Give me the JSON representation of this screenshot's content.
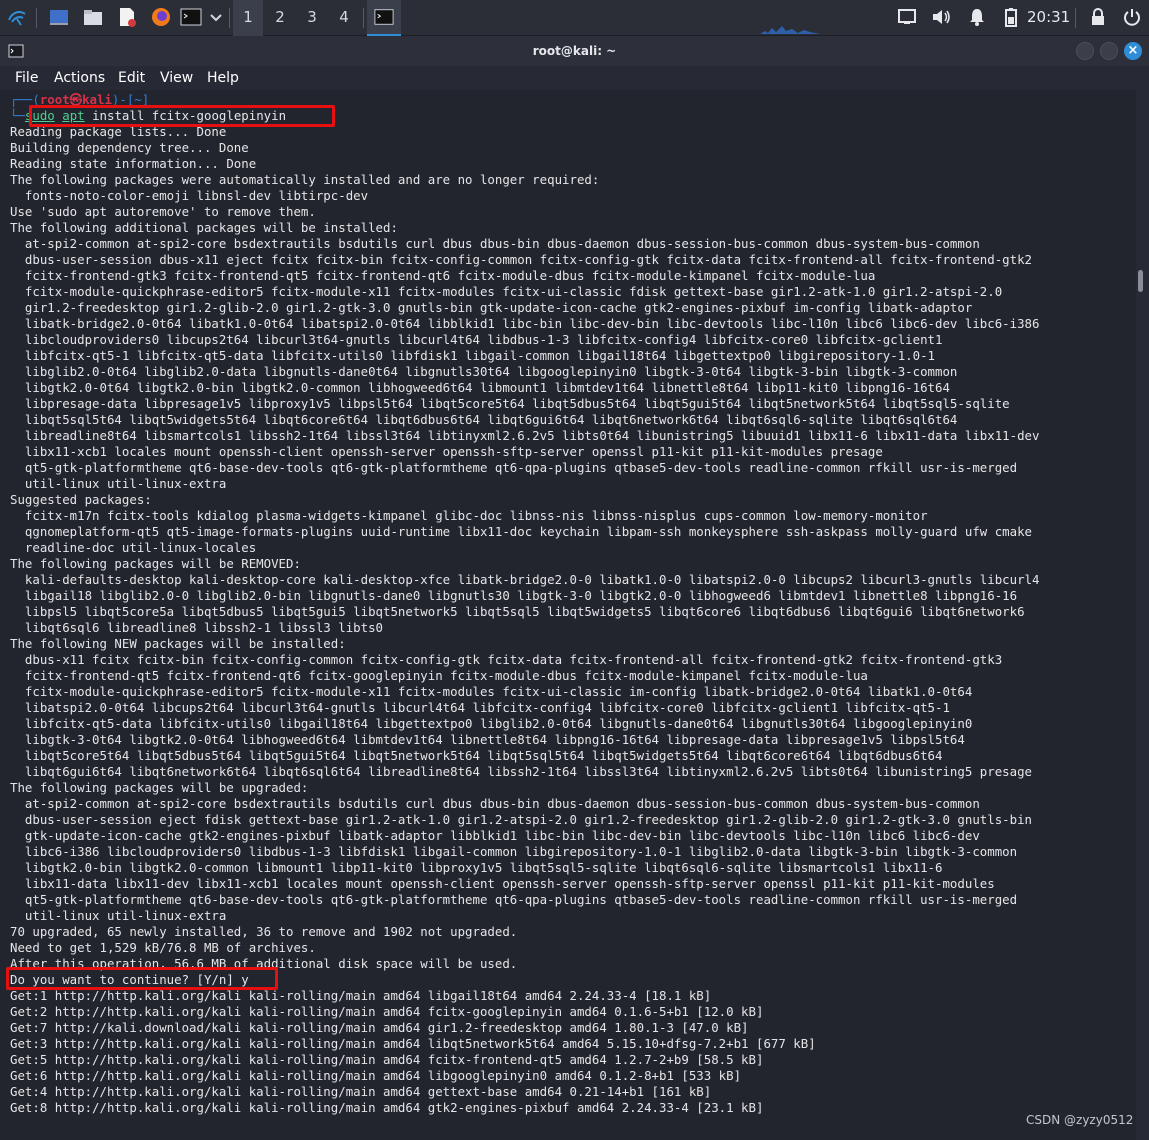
{
  "taskbar": {
    "workspaces": [
      "1",
      "2",
      "3",
      "4"
    ],
    "clock": "20:31"
  },
  "window": {
    "title": "root@kali: ~",
    "menu": [
      "File",
      "Actions",
      "Edit",
      "View",
      "Help"
    ]
  },
  "terminal": {
    "prompt": {
      "top": "┌──(",
      "user": "root㉿kali",
      "path": ")-[~]",
      "hash": "└─",
      "sudo": "sudo",
      "apt": "apt",
      "rest": " install fcitx-googlepinyin"
    },
    "lines": [
      "Reading package lists... Done",
      "Building dependency tree... Done",
      "Reading state information... Done",
      "The following packages were automatically installed and are no longer required:",
      "  fonts-noto-color-emoji libnsl-dev libtirpc-dev",
      "Use 'sudo apt autoremove' to remove them.",
      "The following additional packages will be installed:",
      "  at-spi2-common at-spi2-core bsdextrautils bsdutils curl dbus dbus-bin dbus-daemon dbus-session-bus-common dbus-system-bus-common",
      "  dbus-user-session dbus-x11 eject fcitx fcitx-bin fcitx-config-common fcitx-config-gtk fcitx-data fcitx-frontend-all fcitx-frontend-gtk2",
      "  fcitx-frontend-gtk3 fcitx-frontend-qt5 fcitx-frontend-qt6 fcitx-module-dbus fcitx-module-kimpanel fcitx-module-lua",
      "  fcitx-module-quickphrase-editor5 fcitx-module-x11 fcitx-modules fcitx-ui-classic fdisk gettext-base gir1.2-atk-1.0 gir1.2-atspi-2.0",
      "  gir1.2-freedesktop gir1.2-glib-2.0 gir1.2-gtk-3.0 gnutls-bin gtk-update-icon-cache gtk2-engines-pixbuf im-config libatk-adaptor",
      "  libatk-bridge2.0-0t64 libatk1.0-0t64 libatspi2.0-0t64 libblkid1 libc-bin libc-dev-bin libc-devtools libc-l10n libc6 libc6-dev libc6-i386",
      "  libcloudproviders0 libcups2t64 libcurl3t64-gnutls libcurl4t64 libdbus-1-3 libfcitx-config4 libfcitx-core0 libfcitx-gclient1",
      "  libfcitx-qt5-1 libfcitx-qt5-data libfcitx-utils0 libfdisk1 libgail-common libgail18t64 libgettextpo0 libgirepository-1.0-1",
      "  libglib2.0-0t64 libglib2.0-data libgnutls-dane0t64 libgnutls30t64 libgooglepinyin0 libgtk-3-0t64 libgtk-3-bin libgtk-3-common",
      "  libgtk2.0-0t64 libgtk2.0-bin libgtk2.0-common libhogweed6t64 libmount1 libmtdev1t64 libnettle8t64 libp11-kit0 libpng16-16t64",
      "  libpresage-data libpresage1v5 libproxy1v5 libpsl5t64 libqt5core5t64 libqt5dbus5t64 libqt5gui5t64 libqt5network5t64 libqt5sql5-sqlite",
      "  libqt5sql5t64 libqt5widgets5t64 libqt6core6t64 libqt6dbus6t64 libqt6gui6t64 libqt6network6t64 libqt6sql6-sqlite libqt6sql6t64",
      "  libreadline8t64 libsmartcols1 libssh2-1t64 libssl3t64 libtinyxml2.6.2v5 libts0t64 libunistring5 libuuid1 libx11-6 libx11-data libx11-dev",
      "  libx11-xcb1 locales mount openssh-client openssh-server openssh-sftp-server openssl p11-kit p11-kit-modules presage",
      "  qt5-gtk-platformtheme qt6-base-dev-tools qt6-gtk-platformtheme qt6-qpa-plugins qtbase5-dev-tools readline-common rfkill usr-is-merged",
      "  util-linux util-linux-extra",
      "Suggested packages:",
      "  fcitx-m17n fcitx-tools kdialog plasma-widgets-kimpanel glibc-doc libnss-nis libnss-nisplus cups-common low-memory-monitor",
      "  qgnomeplatform-qt5 qt5-image-formats-plugins uuid-runtime libx11-doc keychain libpam-ssh monkeysphere ssh-askpass molly-guard ufw cmake",
      "  readline-doc util-linux-locales",
      "The following packages will be REMOVED:",
      "  kali-defaults-desktop kali-desktop-core kali-desktop-xfce libatk-bridge2.0-0 libatk1.0-0 libatspi2.0-0 libcups2 libcurl3-gnutls libcurl4",
      "  libgail18 libglib2.0-0 libglib2.0-bin libgnutls-dane0 libgnutls30 libgtk-3-0 libgtk2.0-0 libhogweed6 libmtdev1 libnettle8 libpng16-16",
      "  libpsl5 libqt5core5a libqt5dbus5 libqt5gui5 libqt5network5 libqt5sql5 libqt5widgets5 libqt6core6 libqt6dbus6 libqt6gui6 libqt6network6",
      "  libqt6sql6 libreadline8 libssh2-1 libssl3 libts0",
      "The following NEW packages will be installed:",
      "  dbus-x11 fcitx fcitx-bin fcitx-config-common fcitx-config-gtk fcitx-data fcitx-frontend-all fcitx-frontend-gtk2 fcitx-frontend-gtk3",
      "  fcitx-frontend-qt5 fcitx-frontend-qt6 fcitx-googlepinyin fcitx-module-dbus fcitx-module-kimpanel fcitx-module-lua",
      "  fcitx-module-quickphrase-editor5 fcitx-module-x11 fcitx-modules fcitx-ui-classic im-config libatk-bridge2.0-0t64 libatk1.0-0t64",
      "  libatspi2.0-0t64 libcups2t64 libcurl3t64-gnutls libcurl4t64 libfcitx-config4 libfcitx-core0 libfcitx-gclient1 libfcitx-qt5-1",
      "  libfcitx-qt5-data libfcitx-utils0 libgail18t64 libgettextpo0 libglib2.0-0t64 libgnutls-dane0t64 libgnutls30t64 libgooglepinyin0",
      "  libgtk-3-0t64 libgtk2.0-0t64 libhogweed6t64 libmtdev1t64 libnettle8t64 libpng16-16t64 libpresage-data libpresage1v5 libpsl5t64",
      "  libqt5core5t64 libqt5dbus5t64 libqt5gui5t64 libqt5network5t64 libqt5sql5t64 libqt5widgets5t64 libqt6core6t64 libqt6dbus6t64",
      "  libqt6gui6t64 libqt6network6t64 libqt6sql6t64 libreadline8t64 libssh2-1t64 libssl3t64 libtinyxml2.6.2v5 libts0t64 libunistring5 presage",
      "The following packages will be upgraded:",
      "  at-spi2-common at-spi2-core bsdextrautils bsdutils curl dbus dbus-bin dbus-daemon dbus-session-bus-common dbus-system-bus-common",
      "  dbus-user-session eject fdisk gettext-base gir1.2-atk-1.0 gir1.2-atspi-2.0 gir1.2-freedesktop gir1.2-glib-2.0 gir1.2-gtk-3.0 gnutls-bin",
      "  gtk-update-icon-cache gtk2-engines-pixbuf libatk-adaptor libblkid1 libc-bin libc-dev-bin libc-devtools libc-l10n libc6 libc6-dev",
      "  libc6-i386 libcloudproviders0 libdbus-1-3 libfdisk1 libgail-common libgirepository-1.0-1 libglib2.0-data libgtk-3-bin libgtk-3-common",
      "  libgtk2.0-bin libgtk2.0-common libmount1 libp11-kit0 libproxy1v5 libqt5sql5-sqlite libqt6sql6-sqlite libsmartcols1 libx11-6",
      "  libx11-data libx11-dev libx11-xcb1 locales mount openssh-client openssh-server openssh-sftp-server openssl p11-kit p11-kit-modules",
      "  qt5-gtk-platformtheme qt6-base-dev-tools qt6-gtk-platformtheme qt6-qpa-plugins qtbase5-dev-tools readline-common rfkill usr-is-merged",
      "  util-linux util-linux-extra",
      "70 upgraded, 65 newly installed, 36 to remove and 1902 not upgraded.",
      "Need to get 1,529 kB/76.8 MB of archives.",
      "After this operation, 56.6 MB of additional disk space will be used.",
      "Do you want to continue? [Y/n] y",
      "Get:1 http://http.kali.org/kali kali-rolling/main amd64 libgail18t64 amd64 2.24.33-4 [18.1 kB]",
      "Get:2 http://http.kali.org/kali kali-rolling/main amd64 fcitx-googlepinyin amd64 0.1.6-5+b1 [12.0 kB]",
      "Get:7 http://kali.download/kali kali-rolling/main amd64 gir1.2-freedesktop amd64 1.80.1-3 [47.0 kB]",
      "Get:3 http://http.kali.org/kali kali-rolling/main amd64 libqt5network5t64 amd64 5.15.10+dfsg-7.2+b1 [677 kB]",
      "Get:5 http://http.kali.org/kali kali-rolling/main amd64 fcitx-frontend-qt5 amd64 1.2.7-2+b9 [58.5 kB]",
      "Get:6 http://http.kali.org/kali kali-rolling/main amd64 libgooglepinyin0 amd64 0.1.2-8+b1 [533 kB]",
      "Get:4 http://http.kali.org/kali kali-rolling/main amd64 gettext-base amd64 0.21-14+b1 [161 kB]",
      "Get:8 http://http.kali.org/kali kali-rolling/main amd64 gtk2-engines-pixbuf amd64 2.24.33-4 [23.1 kB]"
    ]
  },
  "watermark": "CSDN @zyzy0512",
  "colors": {
    "prompt_blue": "#2f7fd8",
    "user_red": "#d6334a",
    "cmd_green": "#4ecf8f",
    "highlight": "#e61010",
    "accent": "#2f8dd8"
  }
}
